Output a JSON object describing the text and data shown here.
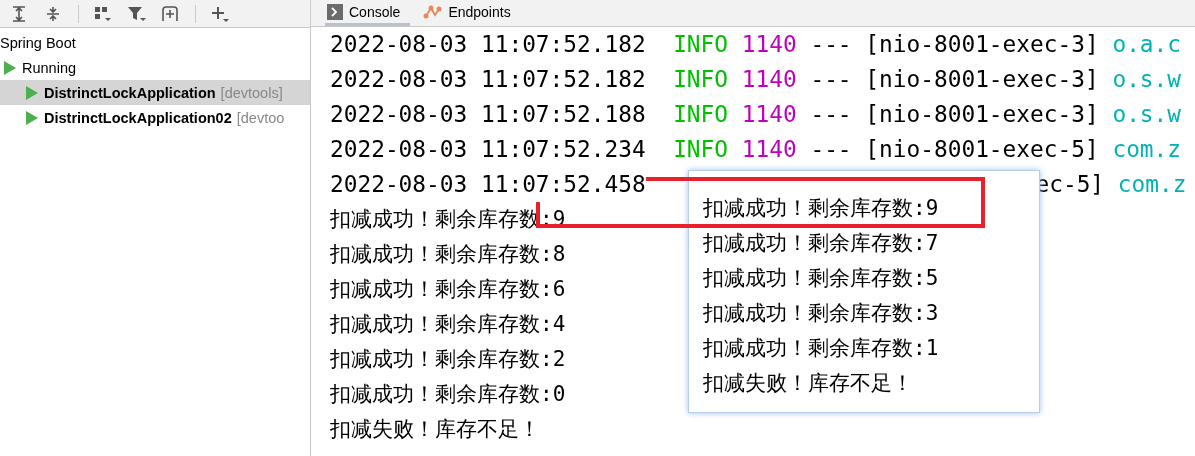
{
  "tree": [
    {
      "label": "Spring Boot",
      "children": [
        {
          "label": "Running",
          "children": [
            {
              "label": "DistrinctLockApplication",
              "tag": "[devtools]",
              "selected": true
            },
            {
              "label": "DistrinctLockApplication02",
              "tag": "[devtoo",
              "selected": false
            }
          ]
        }
      ]
    }
  ],
  "tabs": [
    {
      "label": "Console",
      "selected": true
    },
    {
      "label": "Endpoints",
      "selected": false
    }
  ],
  "console": [
    {
      "kind": "log",
      "time": "2022-08-03 11:07:52.182",
      "level": "INFO",
      "pid": "1140",
      "sep": "---",
      "thread": "[nio-8001-exec-3]",
      "logger": "o.a.c"
    },
    {
      "kind": "log",
      "time": "2022-08-03 11:07:52.182",
      "level": "INFO",
      "pid": "1140",
      "sep": "---",
      "thread": "[nio-8001-exec-3]",
      "logger": "o.s.w"
    },
    {
      "kind": "log",
      "time": "2022-08-03 11:07:52.188",
      "level": "INFO",
      "pid": "1140",
      "sep": "---",
      "thread": "[nio-8001-exec-3]",
      "logger": "o.s.w"
    },
    {
      "kind": "log",
      "time": "2022-08-03 11:07:52.234",
      "level": "INFO",
      "pid": "1140",
      "sep": "---",
      "thread": "[nio-8001-exec-5]",
      "logger": "com.z"
    },
    {
      "kind": "partial",
      "time": "2022-08-03 11:07:52.458",
      "thread": "ec-5]",
      "logger": "com.z"
    },
    {
      "kind": "message",
      "text": "扣减成功！剩余库存数:9"
    },
    {
      "kind": "message",
      "text": "扣减成功！剩余库存数:8"
    },
    {
      "kind": "message",
      "text": "扣减成功！剩余库存数:6"
    },
    {
      "kind": "message",
      "text": "扣减成功！剩余库存数:4"
    },
    {
      "kind": "message",
      "text": "扣减成功！剩余库存数:2"
    },
    {
      "kind": "message",
      "text": "扣减成功！剩余库存数:0"
    },
    {
      "kind": "message",
      "text": "扣减失败！库存不足！"
    }
  ],
  "popup": {
    "lines": [
      "扣减成功！剩余库存数:9",
      "扣减成功！剩余库存数:7",
      "扣减成功！剩余库存数:5",
      "扣减成功！剩余库存数:3",
      "扣减成功！剩余库存数:1",
      "扣减失败！库存不足！"
    ]
  }
}
